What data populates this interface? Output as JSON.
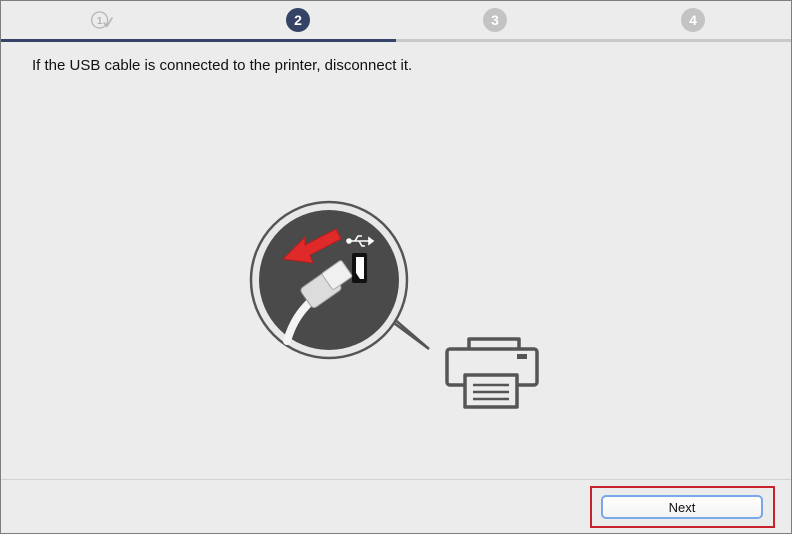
{
  "steps": [
    {
      "label": "1",
      "state": "done"
    },
    {
      "label": "2",
      "state": "active"
    },
    {
      "label": "3",
      "state": "inactive"
    },
    {
      "label": "4",
      "state": "inactive"
    }
  ],
  "instruction": "If the USB cable is connected to the printer, disconnect it.",
  "illustration": {
    "icons": [
      "usb-cable-icon",
      "usb-symbol-icon",
      "unplug-arrow-icon",
      "printer-icon"
    ]
  },
  "footer": {
    "next_label": "Next"
  },
  "colors": {
    "accent": "#354466",
    "inactive_step": "#c3c3c3",
    "highlight": "#c8232c",
    "arrow": "#e02a2a"
  }
}
